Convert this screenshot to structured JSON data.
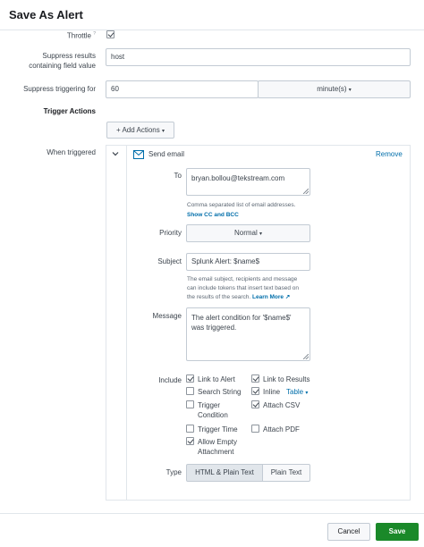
{
  "dialog": {
    "title": "Save As Alert"
  },
  "throttle": {
    "label": "Throttle",
    "marker": "?",
    "checked": true
  },
  "suppress_results": {
    "label_line1": "Suppress results",
    "label_line2": "containing field value",
    "value": "host"
  },
  "suppress_triggering": {
    "label": "Suppress triggering for",
    "value": "60",
    "unit": "minute(s)"
  },
  "trigger_actions": {
    "label": "Trigger Actions",
    "add_button": "+ Add Actions"
  },
  "when_triggered": {
    "label": "When triggered"
  },
  "action": {
    "name": "Send email",
    "remove": "Remove",
    "to_label": "To",
    "to_value": "bryan.bollou@tekstream.com",
    "to_help": "Comma separated list of email addresses.",
    "show_cc": "Show CC and BCC",
    "priority_label": "Priority",
    "priority_value": "Normal",
    "subject_label": "Subject",
    "subject_value": "Splunk Alert: $name$",
    "subject_help_1": "The email subject, recipients and message",
    "subject_help_2": "can include tokens that insert text based on",
    "subject_help_3": "the results of the search.",
    "learn_more": "Learn More",
    "message_label": "Message",
    "message_line1": "The alert condition for '$name$'",
    "message_line2": "was triggered.",
    "include_label": "Include",
    "include": {
      "link_to_alert": {
        "label": "Link to Alert",
        "checked": true
      },
      "link_to_results": {
        "label": "Link to Results",
        "checked": true
      },
      "search_string": {
        "label": "Search String",
        "checked": false
      },
      "inline": {
        "label": "Inline",
        "checked": true,
        "format": "Table"
      },
      "trigger_condition": {
        "label_line1": "Trigger",
        "label_line2": "Condition",
        "checked": false
      },
      "attach_csv": {
        "label": "Attach CSV",
        "checked": true
      },
      "trigger_time": {
        "label": "Trigger Time",
        "checked": false
      },
      "attach_pdf": {
        "label": "Attach PDF",
        "checked": false
      },
      "allow_empty": {
        "label_line1": "Allow Empty",
        "label_line2": "Attachment",
        "checked": true
      }
    },
    "type_label": "Type",
    "type_options": [
      "HTML & Plain Text",
      "Plain Text"
    ],
    "type_selected": "HTML & Plain Text"
  },
  "footer": {
    "cancel": "Cancel",
    "save": "Save"
  },
  "colors": {
    "save": "#1a8929",
    "link": "#006eaa",
    "border": "#c3cbd4"
  }
}
